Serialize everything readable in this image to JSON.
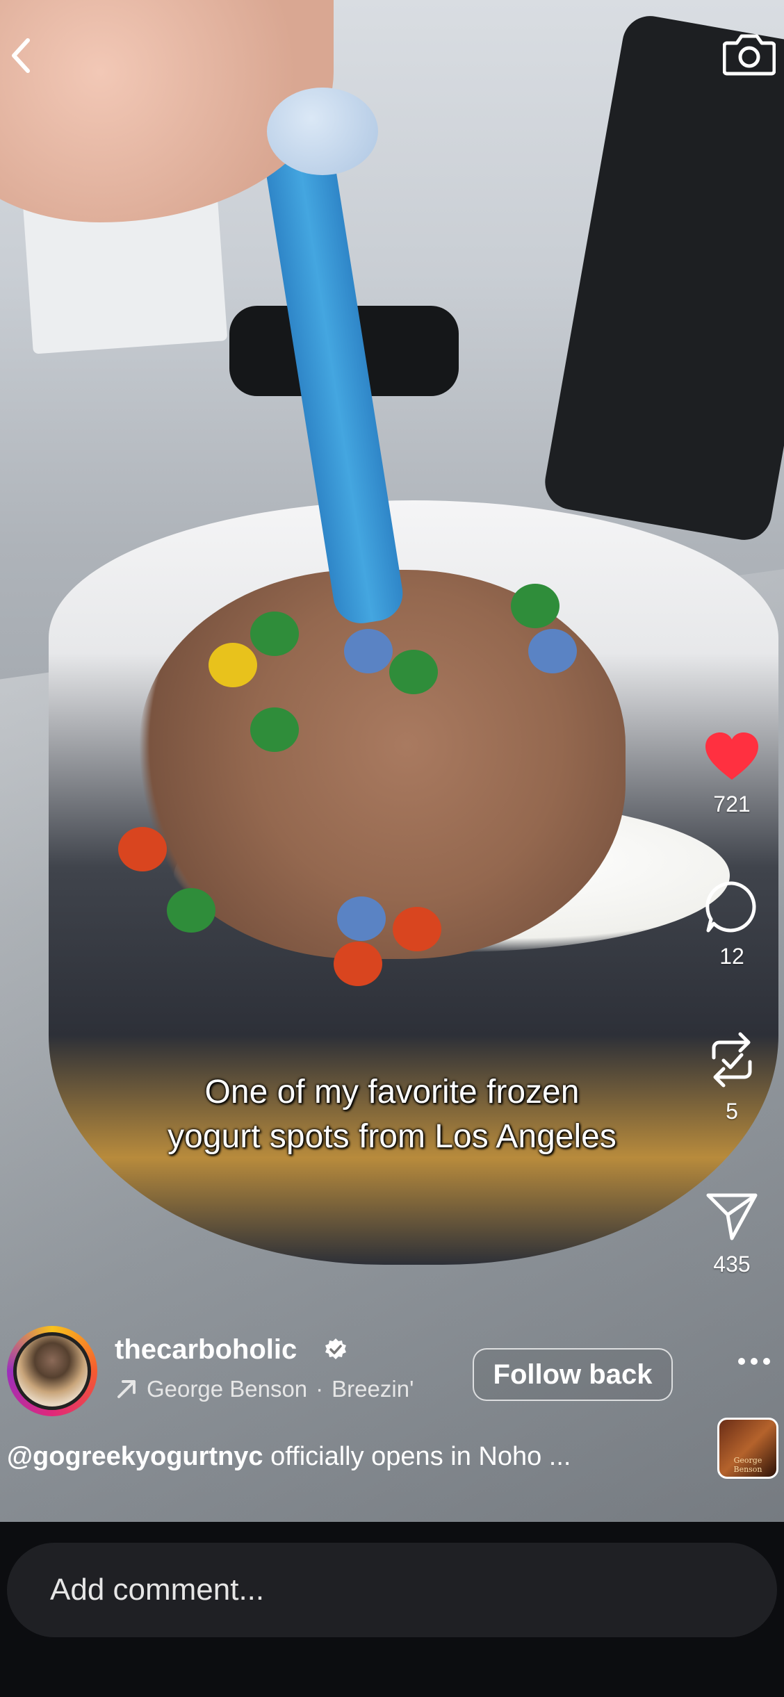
{
  "caption": {
    "line1": "One of my favorite frozen",
    "line2": "yogurt spots from Los Angeles"
  },
  "actions": {
    "likes": "721",
    "comments": "12",
    "reposts": "5",
    "shares": "435",
    "like_color": "#ff3040"
  },
  "author": {
    "username": "thecarboholic",
    "verified": true,
    "music_artist": "George Benson",
    "music_track": "Breezin'",
    "separator": "·",
    "follow_label": "Follow back"
  },
  "description": {
    "mention": "@gogreekyogurtnyc",
    "text": " officially opens in Noho ..."
  },
  "album": {
    "label": "George Benson"
  },
  "comment": {
    "placeholder": "Add comment..."
  },
  "icons": {
    "back": "chevron-left-icon",
    "camera": "camera-icon",
    "like": "heart-icon",
    "comment": "comment-bubble-icon",
    "repost": "repost-icon",
    "share": "send-icon",
    "more": "more-horizontal-icon",
    "music": "arrow-up-right-icon",
    "verified": "verified-badge-icon"
  }
}
